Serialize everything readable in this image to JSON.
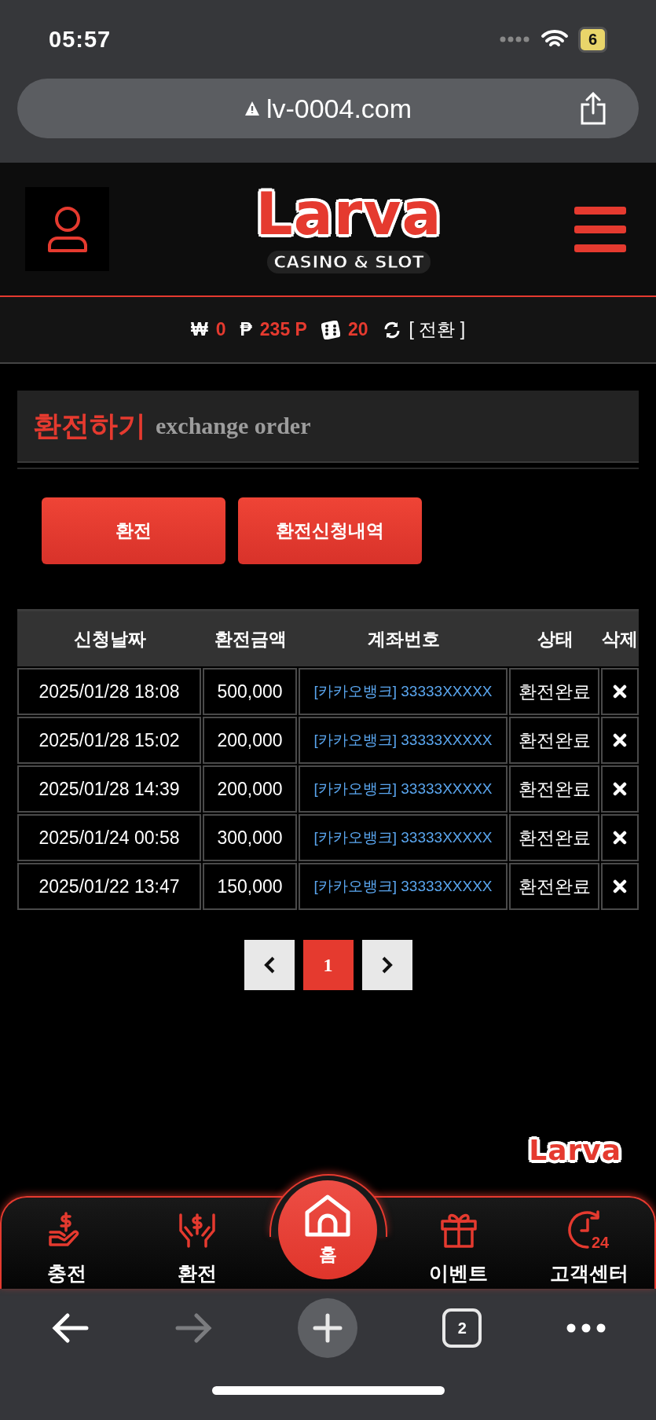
{
  "status_bar": {
    "time": "05:57",
    "battery": "6"
  },
  "browser": {
    "url": "lv-0004.com",
    "tabs_count": "2"
  },
  "header": {
    "logo_word": "Larva",
    "logo_tagline": "CASINO & SLOT"
  },
  "balance": {
    "items": [
      {
        "kind": "won",
        "symbol": "₩",
        "value": "0"
      },
      {
        "kind": "point",
        "symbol": "₱",
        "value": "235 P"
      },
      {
        "kind": "dice",
        "value": "20"
      }
    ],
    "convert_label": "[ 전환 ]"
  },
  "page_title": {
    "korean": "환전하기",
    "english": "exchange order"
  },
  "actions": [
    "환전",
    "환전신청내역"
  ],
  "table": {
    "columns": [
      "신청날짜",
      "환전금액",
      "계좌번호",
      "상태",
      "삭제"
    ],
    "rows": [
      {
        "date": "2025/01/28 18:08",
        "amount": "500,000",
        "account": "[카카오뱅크] 33333XXXXX",
        "status": "환전완료"
      },
      {
        "date": "2025/01/28 15:02",
        "amount": "200,000",
        "account": "[카카오뱅크] 33333XXXXX",
        "status": "환전완료"
      },
      {
        "date": "2025/01/28 14:39",
        "amount": "200,000",
        "account": "[카카오뱅크] 33333XXXXX",
        "status": "환전완료"
      },
      {
        "date": "2025/01/24 00:58",
        "amount": "300,000",
        "account": "[카카오뱅크] 33333XXXXX",
        "status": "환전완료"
      },
      {
        "date": "2025/01/22 13:47",
        "amount": "150,000",
        "account": "[카카오뱅크] 33333XXXXX",
        "status": "환전완료"
      }
    ]
  },
  "pagination": {
    "pages": [
      {
        "label": "1",
        "selected": true
      }
    ]
  },
  "footer_logo": {
    "word": "Larva"
  },
  "bottom_nav": [
    {
      "kind": "charge",
      "label": "충전"
    },
    {
      "kind": "exchange",
      "label": "환전"
    },
    {
      "kind": "home",
      "label": "홈"
    },
    {
      "kind": "event",
      "label": "이벤트"
    },
    {
      "kind": "support",
      "label": "고객센터",
      "badge": "24"
    }
  ]
}
